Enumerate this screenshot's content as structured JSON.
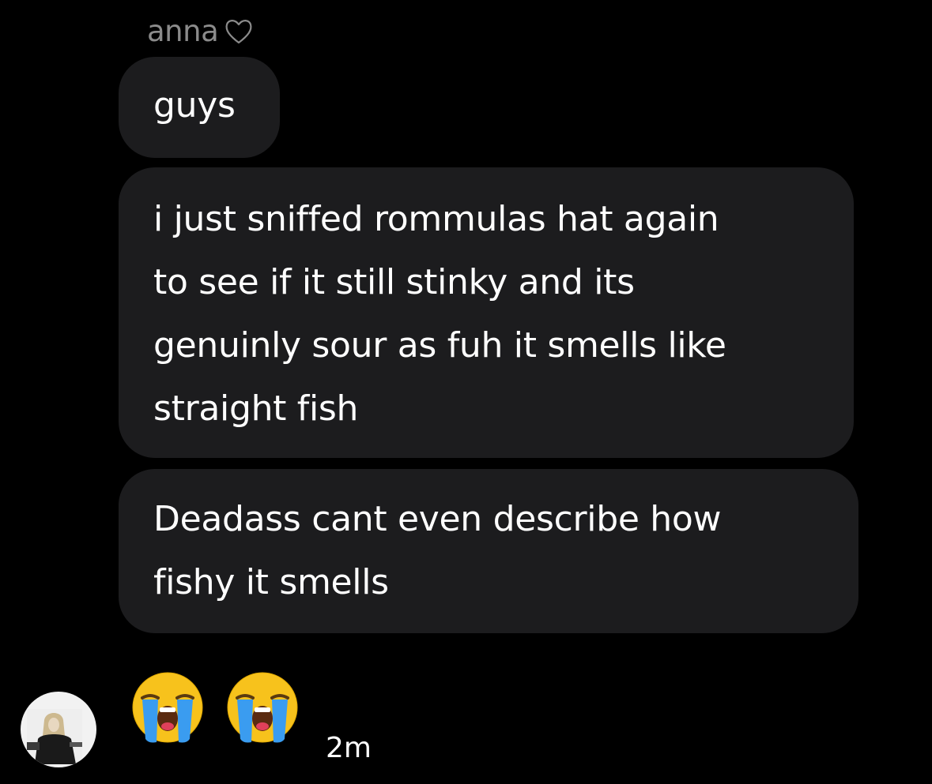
{
  "sender": {
    "name": "anna",
    "name_icon": "heart-outline-icon"
  },
  "messages": [
    {
      "lines": [
        "guys"
      ]
    },
    {
      "lines": [
        "i just sniffed rommulas hat again",
        "to see if it still stinky and its",
        "genuinly sour as fuh it smells like",
        "straight fish"
      ]
    },
    {
      "lines": [
        "Deadass cant even describe how",
        "fishy it smells"
      ]
    }
  ],
  "reactions": [
    {
      "emoji": "loudly-crying-face-icon"
    },
    {
      "emoji": "loudly-crying-face-icon"
    }
  ],
  "timestamp": "2m",
  "colors": {
    "background": "#000000",
    "bubble": "#1c1c1e",
    "sender_name": "#8b8b8b",
    "text": "#ffffff"
  }
}
